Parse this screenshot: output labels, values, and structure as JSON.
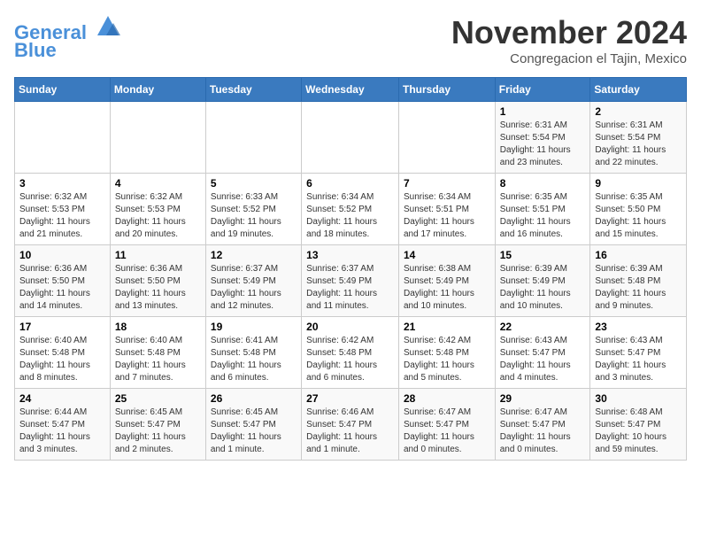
{
  "logo": {
    "line1": "General",
    "line2": "Blue"
  },
  "title": "November 2024",
  "location": "Congregacion el Tajin, Mexico",
  "days_of_week": [
    "Sunday",
    "Monday",
    "Tuesday",
    "Wednesday",
    "Thursday",
    "Friday",
    "Saturday"
  ],
  "weeks": [
    [
      {
        "day": "",
        "info": ""
      },
      {
        "day": "",
        "info": ""
      },
      {
        "day": "",
        "info": ""
      },
      {
        "day": "",
        "info": ""
      },
      {
        "day": "",
        "info": ""
      },
      {
        "day": "1",
        "info": "Sunrise: 6:31 AM\nSunset: 5:54 PM\nDaylight: 11 hours and 23 minutes."
      },
      {
        "day": "2",
        "info": "Sunrise: 6:31 AM\nSunset: 5:54 PM\nDaylight: 11 hours and 22 minutes."
      }
    ],
    [
      {
        "day": "3",
        "info": "Sunrise: 6:32 AM\nSunset: 5:53 PM\nDaylight: 11 hours and 21 minutes."
      },
      {
        "day": "4",
        "info": "Sunrise: 6:32 AM\nSunset: 5:53 PM\nDaylight: 11 hours and 20 minutes."
      },
      {
        "day": "5",
        "info": "Sunrise: 6:33 AM\nSunset: 5:52 PM\nDaylight: 11 hours and 19 minutes."
      },
      {
        "day": "6",
        "info": "Sunrise: 6:34 AM\nSunset: 5:52 PM\nDaylight: 11 hours and 18 minutes."
      },
      {
        "day": "7",
        "info": "Sunrise: 6:34 AM\nSunset: 5:51 PM\nDaylight: 11 hours and 17 minutes."
      },
      {
        "day": "8",
        "info": "Sunrise: 6:35 AM\nSunset: 5:51 PM\nDaylight: 11 hours and 16 minutes."
      },
      {
        "day": "9",
        "info": "Sunrise: 6:35 AM\nSunset: 5:50 PM\nDaylight: 11 hours and 15 minutes."
      }
    ],
    [
      {
        "day": "10",
        "info": "Sunrise: 6:36 AM\nSunset: 5:50 PM\nDaylight: 11 hours and 14 minutes."
      },
      {
        "day": "11",
        "info": "Sunrise: 6:36 AM\nSunset: 5:50 PM\nDaylight: 11 hours and 13 minutes."
      },
      {
        "day": "12",
        "info": "Sunrise: 6:37 AM\nSunset: 5:49 PM\nDaylight: 11 hours and 12 minutes."
      },
      {
        "day": "13",
        "info": "Sunrise: 6:37 AM\nSunset: 5:49 PM\nDaylight: 11 hours and 11 minutes."
      },
      {
        "day": "14",
        "info": "Sunrise: 6:38 AM\nSunset: 5:49 PM\nDaylight: 11 hours and 10 minutes."
      },
      {
        "day": "15",
        "info": "Sunrise: 6:39 AM\nSunset: 5:49 PM\nDaylight: 11 hours and 10 minutes."
      },
      {
        "day": "16",
        "info": "Sunrise: 6:39 AM\nSunset: 5:48 PM\nDaylight: 11 hours and 9 minutes."
      }
    ],
    [
      {
        "day": "17",
        "info": "Sunrise: 6:40 AM\nSunset: 5:48 PM\nDaylight: 11 hours and 8 minutes."
      },
      {
        "day": "18",
        "info": "Sunrise: 6:40 AM\nSunset: 5:48 PM\nDaylight: 11 hours and 7 minutes."
      },
      {
        "day": "19",
        "info": "Sunrise: 6:41 AM\nSunset: 5:48 PM\nDaylight: 11 hours and 6 minutes."
      },
      {
        "day": "20",
        "info": "Sunrise: 6:42 AM\nSunset: 5:48 PM\nDaylight: 11 hours and 6 minutes."
      },
      {
        "day": "21",
        "info": "Sunrise: 6:42 AM\nSunset: 5:48 PM\nDaylight: 11 hours and 5 minutes."
      },
      {
        "day": "22",
        "info": "Sunrise: 6:43 AM\nSunset: 5:47 PM\nDaylight: 11 hours and 4 minutes."
      },
      {
        "day": "23",
        "info": "Sunrise: 6:43 AM\nSunset: 5:47 PM\nDaylight: 11 hours and 3 minutes."
      }
    ],
    [
      {
        "day": "24",
        "info": "Sunrise: 6:44 AM\nSunset: 5:47 PM\nDaylight: 11 hours and 3 minutes."
      },
      {
        "day": "25",
        "info": "Sunrise: 6:45 AM\nSunset: 5:47 PM\nDaylight: 11 hours and 2 minutes."
      },
      {
        "day": "26",
        "info": "Sunrise: 6:45 AM\nSunset: 5:47 PM\nDaylight: 11 hours and 1 minute."
      },
      {
        "day": "27",
        "info": "Sunrise: 6:46 AM\nSunset: 5:47 PM\nDaylight: 11 hours and 1 minute."
      },
      {
        "day": "28",
        "info": "Sunrise: 6:47 AM\nSunset: 5:47 PM\nDaylight: 11 hours and 0 minutes."
      },
      {
        "day": "29",
        "info": "Sunrise: 6:47 AM\nSunset: 5:47 PM\nDaylight: 11 hours and 0 minutes."
      },
      {
        "day": "30",
        "info": "Sunrise: 6:48 AM\nSunset: 5:47 PM\nDaylight: 10 hours and 59 minutes."
      }
    ]
  ]
}
